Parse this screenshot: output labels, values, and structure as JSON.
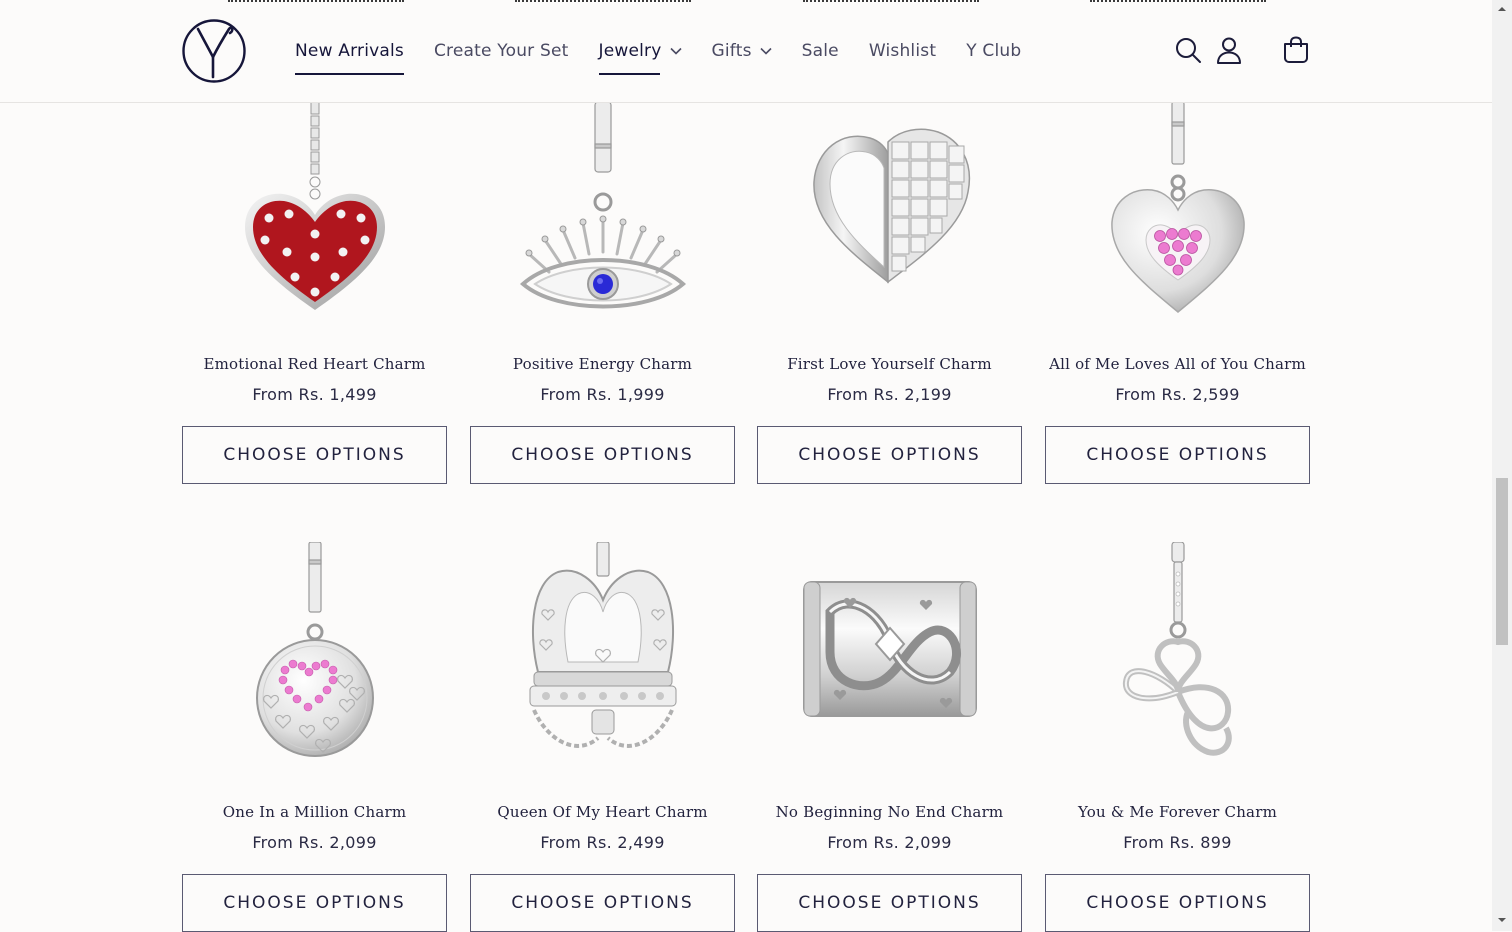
{
  "header": {
    "logo_alt": "Y",
    "nav": [
      {
        "label": "New Arrivals",
        "active": true,
        "dropdown": false
      },
      {
        "label": "Create Your Set",
        "active": false,
        "dropdown": false
      },
      {
        "label": "Jewelry",
        "active": true,
        "dropdown": true
      },
      {
        "label": "Gifts",
        "active": false,
        "dropdown": true
      },
      {
        "label": "Sale",
        "active": false,
        "dropdown": false
      },
      {
        "label": "Wishlist",
        "active": false,
        "dropdown": false
      },
      {
        "label": "Y Club",
        "active": false,
        "dropdown": false
      }
    ],
    "icons": [
      "search-icon",
      "account-icon",
      "cart-icon"
    ]
  },
  "products": [
    {
      "title": "Emotional Red Heart Charm",
      "price": "From Rs. 1,499",
      "button": "CHOOSE OPTIONS",
      "image": "red-heart-charm"
    },
    {
      "title": "Positive Energy Charm",
      "price": "From Rs. 1,999",
      "button": "CHOOSE OPTIONS",
      "image": "evil-eye-charm"
    },
    {
      "title": "First Love Yourself Charm",
      "price": "From Rs. 2,199",
      "button": "CHOOSE OPTIONS",
      "image": "split-heart-charm"
    },
    {
      "title": "All of Me Loves All of You Charm",
      "price": "From Rs. 2,599",
      "button": "CHOOSE OPTIONS",
      "image": "pink-stone-heart-charm"
    },
    {
      "title": "One In a Million Charm",
      "price": "From Rs. 2,099",
      "button": "CHOOSE OPTIONS",
      "image": "round-heart-medallion-charm"
    },
    {
      "title": "Queen Of My Heart Charm",
      "price": "From Rs. 2,499",
      "button": "CHOOSE OPTIONS",
      "image": "crown-charm"
    },
    {
      "title": "No Beginning No End Charm",
      "price": "From Rs. 2,099",
      "button": "CHOOSE OPTIONS",
      "image": "infinity-barrel-charm"
    },
    {
      "title": "You & Me Forever Charm",
      "price": "From Rs. 899",
      "button": "CHOOSE OPTIONS",
      "image": "infinity-heart-charm"
    }
  ],
  "colors": {
    "background": "#fcfbfa",
    "text": "#1c1c3a",
    "button_border": "#5a5a72",
    "enamel_red": "#b0161e",
    "sapphire": "#2a2ad6",
    "pink_stone": "#ec7bd0"
  }
}
